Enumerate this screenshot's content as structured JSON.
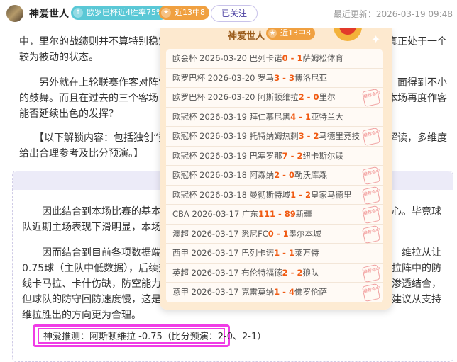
{
  "header": {
    "username": "神爱世人",
    "badge_trend": "欧罗巴杯近4胜率75%",
    "badge_record": "近13中8",
    "follow_label": "已关注",
    "update_label": "最近更新：",
    "update_time": "2026-03-19 09:48"
  },
  "article": {
    "lines": [
      {
        "l": "中，里尔的战绩则并不算特别稳定，",
        "r": "真正处于一个"
      },
      {
        "l": "较为被动的状态。",
        "r": ""
      },
      {
        "l": "　　另外就在上轮联赛作客对阵雷恩",
        "r": "面得到不小"
      },
      {
        "l": "的鼓舞。而且在过去的三个客场，里",
        "r": "本场再度作客"
      },
      {
        "l": "能否延续出色的发挥？",
        "r": ""
      },
      {
        "l": "　　【以下解锁内容：包括独创“数",
        "r": "解读，多维度"
      },
      {
        "l": "给出合理参考及比分预演。】",
        "r": ""
      }
    ],
    "locked_lines": [
      {
        "l": "　　因此结合到本场比赛的基本面分",
        "r": "心。毕竟球"
      },
      {
        "l": "队近期主场表现下滑明显，本场自然",
        "r": ""
      },
      {
        "l": "　　因而结合到目前各项数据端的表",
        "r": "维拉从让"
      },
      {
        "l": "0.75球（主队中低数据），后续升至",
        "r": "拉阵中的防"
      },
      {
        "l": "线卡马拉、卡什伤缺，防空能力存在",
        "r": "渗透结合，"
      },
      {
        "l": "但球队的防守回防速度慢，这是一个",
        "r": "建议从支持"
      },
      {
        "l": "维拉胜出的方向更为合理。",
        "r": ""
      }
    ],
    "prediction": "神爱推测：阿斯顿维拉 -0.75（比分预演：2-0、2-1）"
  },
  "popup": {
    "title": "神爱世人",
    "record": "近13中8",
    "hit_stamp": "推荐命中",
    "records": [
      {
        "league": "欧会杯",
        "date": "2026-03-20",
        "home": "巴列卡诺",
        "hs": "0",
        "as": "1",
        "away": "萨姆松体育",
        "hit": false
      },
      {
        "league": "欧罗巴杯",
        "date": "2026-03-20",
        "home": "罗马",
        "hs": "3",
        "as": "3",
        "away": "博洛尼亚",
        "hit": false
      },
      {
        "league": "欧罗巴杯",
        "date": "2026-03-20",
        "home": "阿斯顿维拉",
        "hs": "2",
        "as": "0",
        "away": "里尔",
        "hit": true
      },
      {
        "league": "欧冠杯",
        "date": "2026-03-19",
        "home": "拜仁慕尼黑",
        "hs": "4",
        "as": "1",
        "away": "亚特兰大",
        "hit": false
      },
      {
        "league": "欧冠杯",
        "date": "2026-03-19",
        "home": "托特纳姆热刺",
        "hs": "3",
        "as": "2",
        "away": "马德里竞技",
        "hit": true
      },
      {
        "league": "欧冠杯",
        "date": "2026-03-19",
        "home": "巴塞罗那",
        "hs": "7",
        "as": "2",
        "away": "纽卡斯尔联",
        "hit": false
      },
      {
        "league": "欧冠杯",
        "date": "2026-03-18",
        "home": "阿森纳",
        "hs": "2",
        "as": "0",
        "away": "勒沃库森",
        "hit": true
      },
      {
        "league": "欧冠杯",
        "date": "2026-03-18",
        "home": "曼彻斯特城",
        "hs": "1",
        "as": "2",
        "away": "皇家马德里",
        "hit": true
      },
      {
        "league": "CBA",
        "date": "2026-03-17",
        "home": "广东",
        "hs": "111",
        "as": "89",
        "away": "新疆",
        "hit": true
      },
      {
        "league": "澳超",
        "date": "2026-03-17",
        "home": "悉尼FC",
        "hs": "0",
        "as": "1",
        "away": "墨尔本城",
        "hit": true
      },
      {
        "league": "西甲",
        "date": "2026-03-17",
        "home": "巴列卡诺",
        "hs": "1",
        "as": "1",
        "away": "莱万特",
        "hit": false
      },
      {
        "league": "英超",
        "date": "2026-03-17",
        "home": "布伦特福德",
        "hs": "2",
        "as": "2",
        "away": "狼队",
        "hit": true
      },
      {
        "league": "意甲",
        "date": "2026-03-17",
        "home": "克雷莫纳",
        "hs": "1",
        "as": "4",
        "away": "佛罗伦萨",
        "hit": true
      }
    ]
  },
  "colors": {
    "score": "#f05a12",
    "highlight": "#f03ce6",
    "trend_badge": "#5ac8d6",
    "record_badge": "#f0a040"
  }
}
